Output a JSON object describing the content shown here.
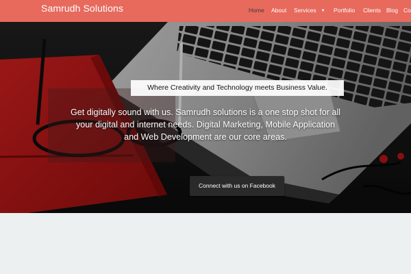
{
  "header": {
    "brand": "Samrudh Solutions",
    "nav": [
      {
        "label": "Home",
        "active": true
      },
      {
        "label": "About"
      },
      {
        "label": "Services",
        "has_dropdown": true
      },
      {
        "label": "Portfolio"
      },
      {
        "label": "Clients"
      },
      {
        "label": "Blog"
      },
      {
        "label": "Co"
      }
    ]
  },
  "hero": {
    "tagline": "Where Creativity and Technology meets Business Value.",
    "description": "Get digitally sound with us. Samrudh solutions is a one stop shot for all your digital and internet needs. Digital Marketing, Mobile Application and Web Development are our core areas.",
    "cta_label": "Connect with us on Facebook"
  },
  "colors": {
    "navbar_bg": "#e76a5d",
    "active_nav": "#3a3a3a",
    "page_bg": "#ecf0f1",
    "cta_bg": "#2a2a2a"
  },
  "icons": {
    "dropdown": "chevron-down-icon"
  }
}
